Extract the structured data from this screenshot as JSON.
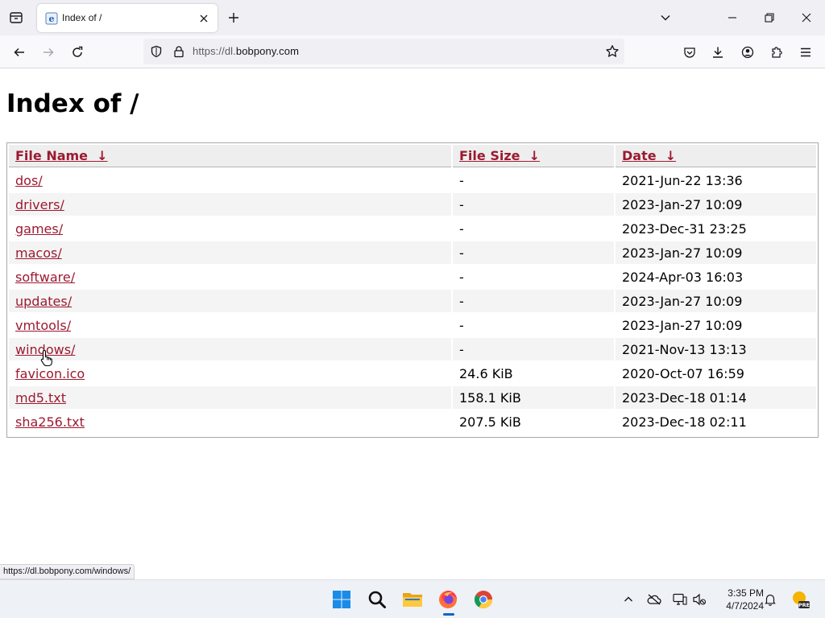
{
  "browser": {
    "tab": {
      "title": "Index of /"
    },
    "url": {
      "scheme_prefix": "https://dl.",
      "domain": "bobpony.com"
    }
  },
  "page": {
    "title": "Index of /",
    "columns": {
      "name": "File Name",
      "size": "File Size",
      "date": "Date",
      "sort_arrow": "↓"
    },
    "rows": [
      {
        "name": "dos/",
        "size": "-",
        "date": "2021-Jun-22 13:36"
      },
      {
        "name": "drivers/",
        "size": "-",
        "date": "2023-Jan-27 10:09"
      },
      {
        "name": "games/",
        "size": "-",
        "date": "2023-Dec-31 23:25"
      },
      {
        "name": "macos/",
        "size": "-",
        "date": "2023-Jan-27 10:09"
      },
      {
        "name": "software/",
        "size": "-",
        "date": "2024-Apr-03 16:03"
      },
      {
        "name": "updates/",
        "size": "-",
        "date": "2023-Jan-27 10:09"
      },
      {
        "name": "vmtools/",
        "size": "-",
        "date": "2023-Jan-27 10:09"
      },
      {
        "name": "windows/",
        "size": "-",
        "date": "2021-Nov-13 13:13"
      },
      {
        "name": "favicon.ico",
        "size": "24.6 KiB",
        "date": "2020-Oct-07 16:59"
      },
      {
        "name": "md5.txt",
        "size": "158.1 KiB",
        "date": "2023-Dec-18 01:14"
      },
      {
        "name": "sha256.txt",
        "size": "207.5 KiB",
        "date": "2023-Dec-18 02:11"
      }
    ],
    "status_link": "https://dl.bobpony.com/windows/"
  },
  "taskbar": {
    "apps": [
      "start-icon",
      "search-icon",
      "file-explorer-icon",
      "firefox-icon",
      "chrome-icon"
    ],
    "clock": {
      "time": "3:35 PM",
      "date": "4/7/2024"
    },
    "weather_badge": "PRE"
  },
  "colors": {
    "link": "#9c1a31",
    "header_bg": "#eeeeee",
    "row_alt_bg": "#f4f4f4",
    "chrome_bg": "#f0f0f4"
  }
}
